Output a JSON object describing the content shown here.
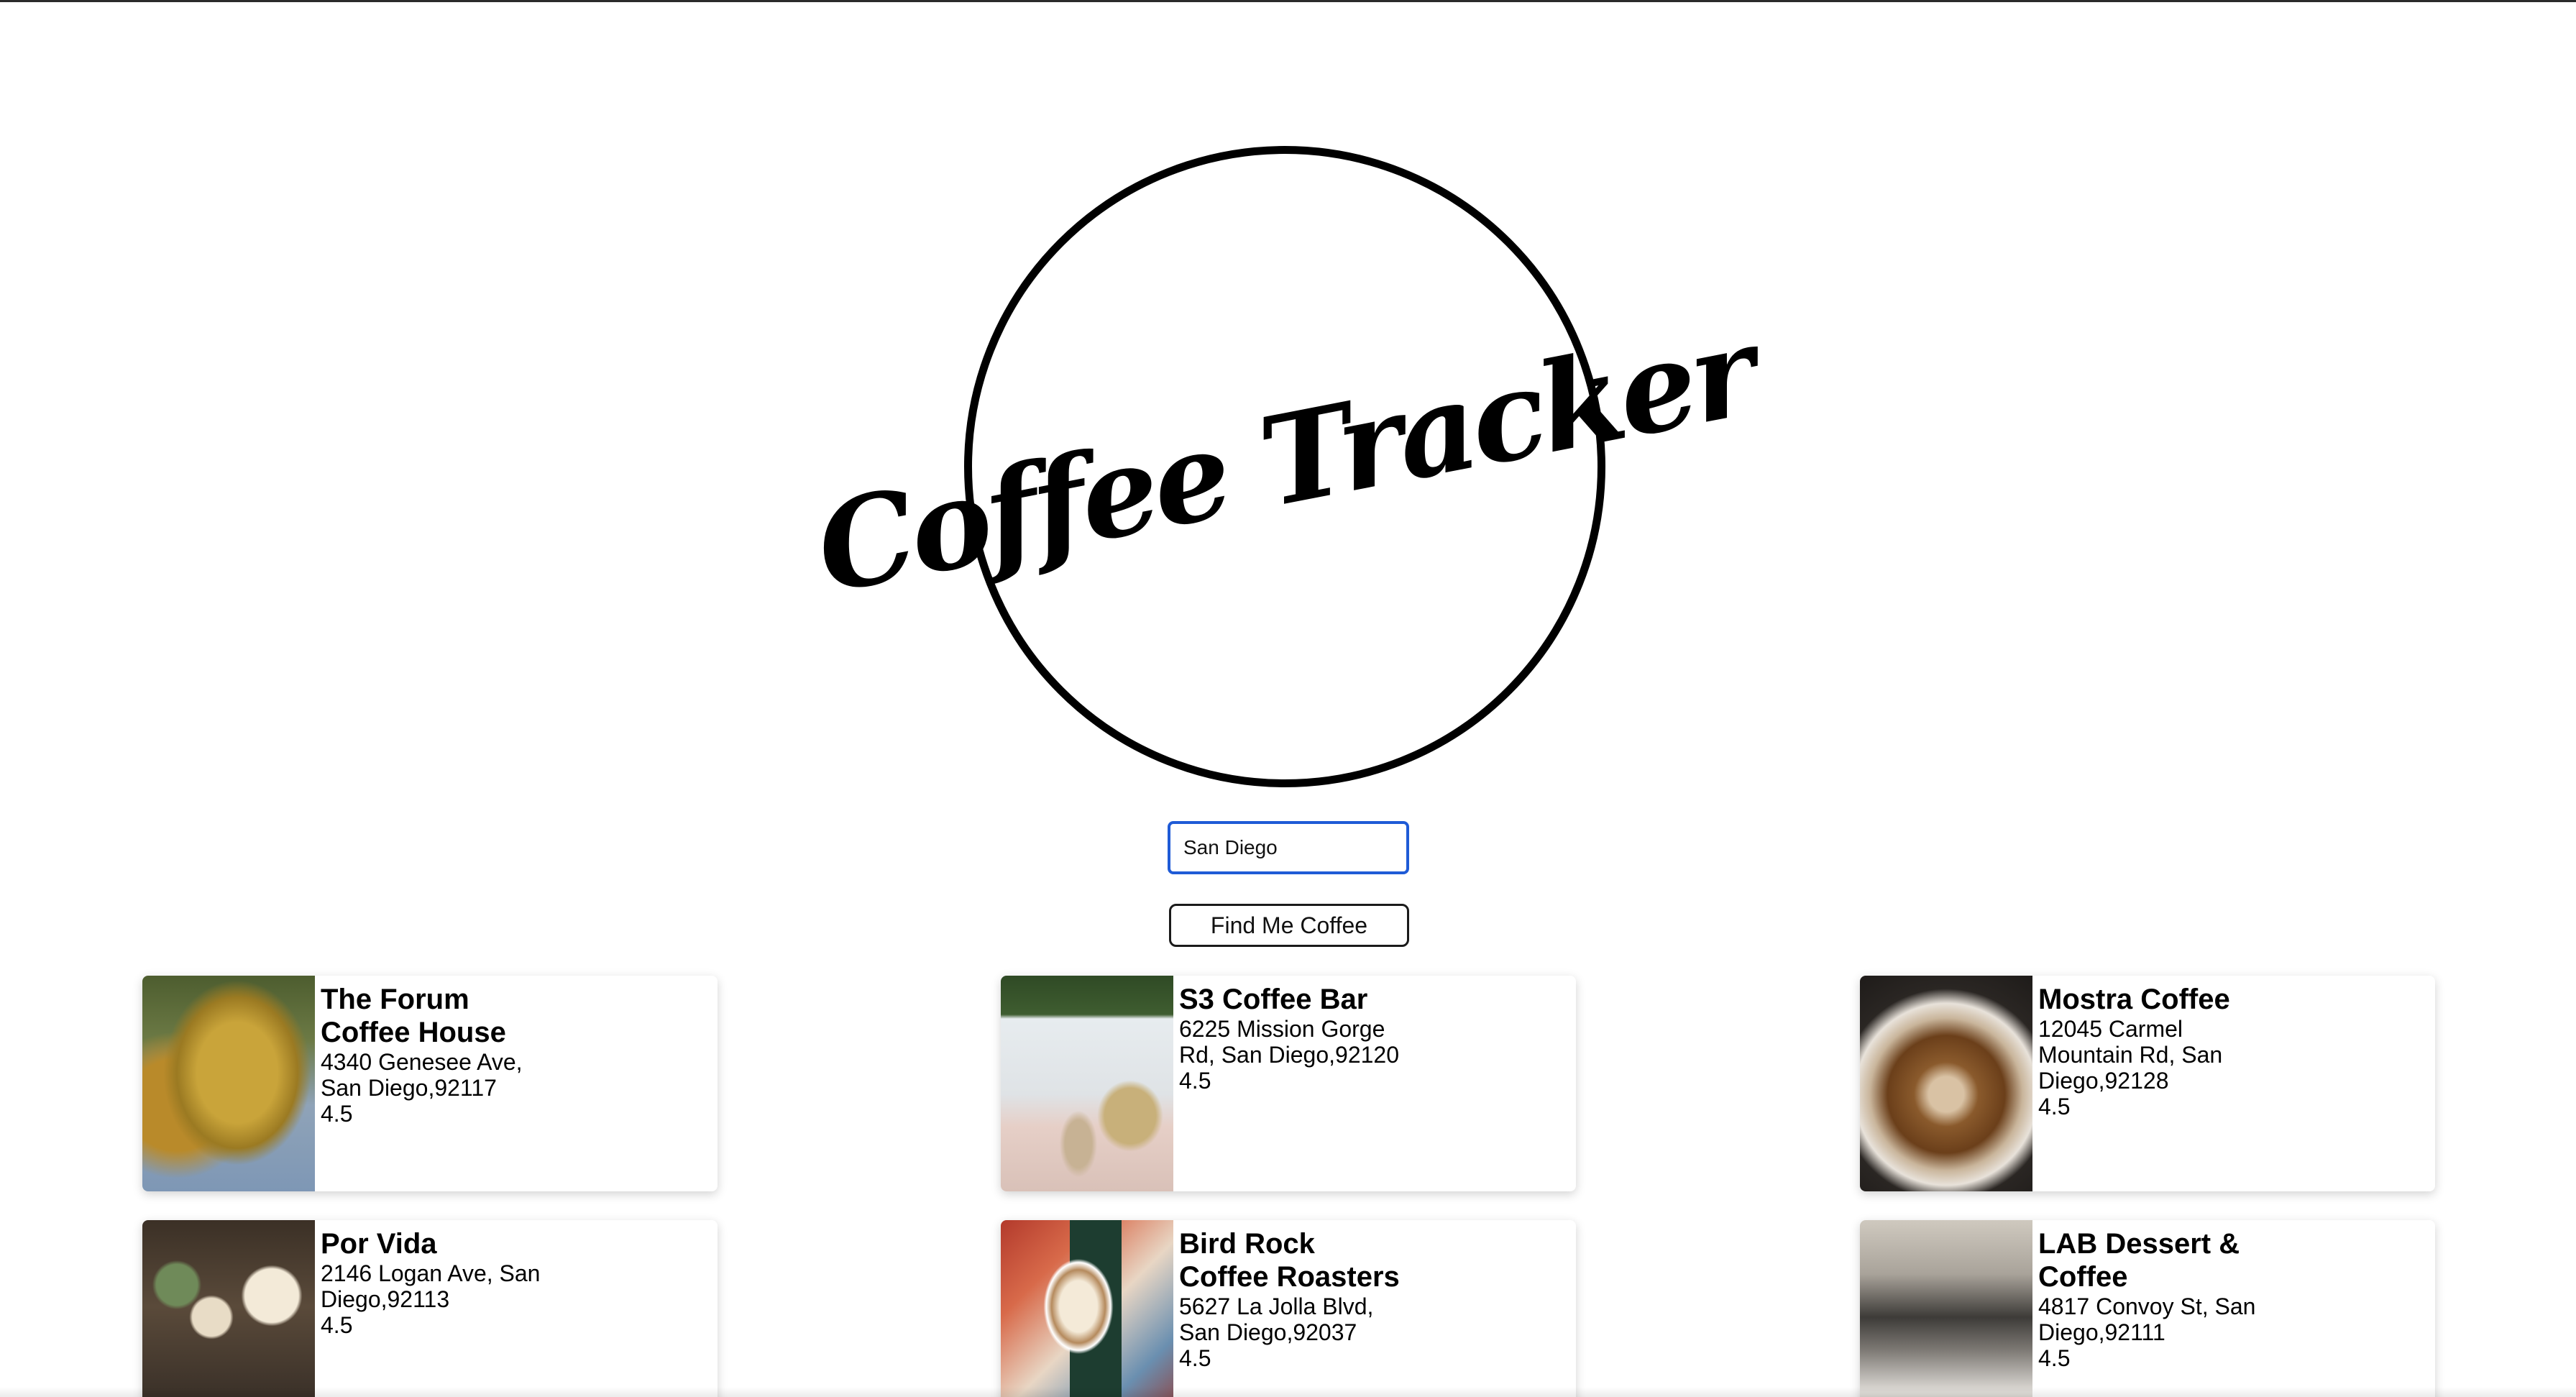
{
  "logo": {
    "text": "Coffee Tracker"
  },
  "search": {
    "value": "San Diego",
    "placeholder": ""
  },
  "actions": {
    "find_label": "Find Me Coffee"
  },
  "shops": [
    {
      "name": "The Forum Coffee House",
      "address": "4340 Genesee Ave, San Diego,92117",
      "rating": "4.5",
      "image": "croissant-photo"
    },
    {
      "name": "S3 Coffee Bar",
      "address": "6225 Mission Gorge Rd, San Diego,92120",
      "rating": "4.5",
      "image": "cafe-interior-photo"
    },
    {
      "name": "Mostra Coffee",
      "address": "12045 Carmel Mountain Rd, San Diego,92128",
      "rating": "4.5",
      "image": "latte-art-photo"
    },
    {
      "name": "Por Vida",
      "address": "2146 Logan Ave, San Diego,92113",
      "rating": "4.5",
      "image": "whipped-drinks-photo"
    },
    {
      "name": "Bird Rock Coffee Roasters",
      "address": "5627 La Jolla Blvd, San Diego,92037",
      "rating": "4.5",
      "image": "coffee-cup-photo"
    },
    {
      "name": "LAB Dessert & Coffee",
      "address": "4817 Convoy St, San Diego,92111",
      "rating": "4.5",
      "image": "espresso-machine-photo"
    }
  ]
}
